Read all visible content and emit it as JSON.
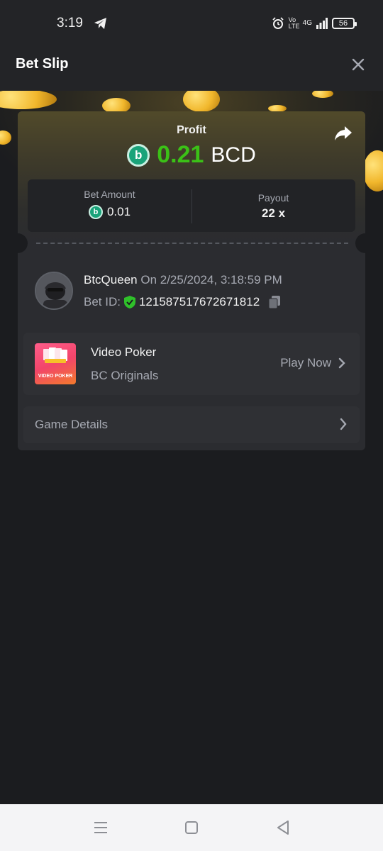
{
  "status_bar": {
    "time": "3:19",
    "network": "4G",
    "volte": "Vo LTE",
    "battery": "56"
  },
  "header": {
    "title": "Bet Slip"
  },
  "profit": {
    "label": "Profit",
    "value": "0.21",
    "currency": "BCD",
    "value_color": "#3bc117"
  },
  "stats": {
    "bet_amount_label": "Bet Amount",
    "bet_amount_value": "0.01",
    "payout_label": "Payout",
    "payout_value": "22 x"
  },
  "bet_info": {
    "username": "BtcQueen",
    "date_text": "On 2/25/2024, 3:18:59 PM",
    "bet_id_label": "Bet ID:",
    "bet_id_value": "121587517672671812"
  },
  "game": {
    "name": "Video Poker",
    "provider": "BC Originals",
    "thumb_text": "VIDEO POKER",
    "play_label": "Play Now"
  },
  "details": {
    "label": "Game Details"
  },
  "colors": {
    "accent_green": "#3bc117",
    "bcd_coin": "#1aa37a",
    "background": "#1b1c1f",
    "card": "#2b2c30"
  }
}
